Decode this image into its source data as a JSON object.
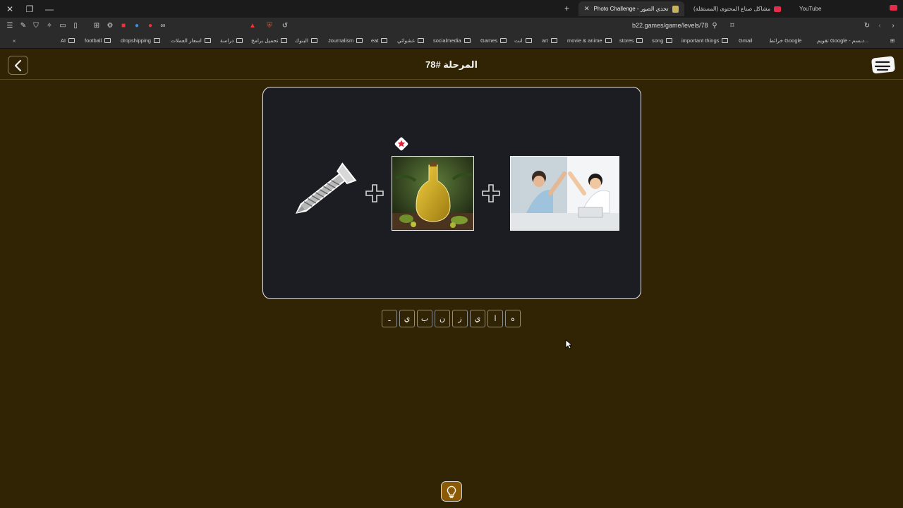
{
  "browser": {
    "tabs": {
      "active_title": "Photo Challenge - تحدي الصور",
      "tab2_title": "مشاكل صناع المحتوى (المستقلة)",
      "tab3_title": "YouTube"
    },
    "url": "b22.games/game/levels/78",
    "bookmarks": [
      "AI",
      "football",
      "dropshipping",
      "اسعار العملات",
      "دراسة",
      "تحميل برامج",
      "البنوك",
      "Journalism",
      "eat",
      "عشوائي",
      "socialmedia",
      "Games",
      "انت",
      "art",
      "movie & anime",
      "stores",
      "song",
      "important things",
      "Gmail",
      "خرائط Google",
      "تقويم Google - دبسم..."
    ]
  },
  "header": {
    "title": "المرحلة #78",
    "logo_text": "تحدي الصور"
  },
  "puzzle": {
    "images": [
      "screw",
      "olive-oil",
      "high-five"
    ],
    "answer_slots": [
      "ـ",
      "ي",
      "ب",
      "ن",
      "ز",
      "ي",
      "ا",
      "ه"
    ]
  },
  "icons": {
    "back": "chevron-left-icon",
    "hint": "lightbulb-icon",
    "badge": "star-badge-icon"
  },
  "colors": {
    "page_bg": "#302405",
    "card_bg": "#1b1d22",
    "hint_bg": "#8a5a06"
  }
}
